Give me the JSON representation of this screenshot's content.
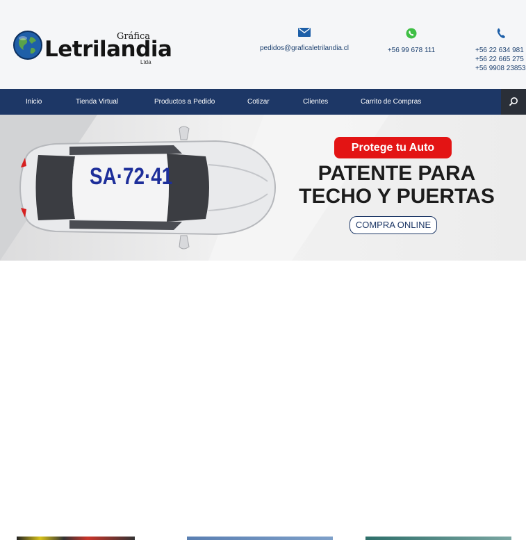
{
  "header": {
    "logo": {
      "small": "Gráfica",
      "main": "Letrilandia",
      "ltda": "Ltda"
    },
    "email": "pedidos@graficaletrilandia.cl",
    "whatsapp": "+56 99 678 111",
    "phones": [
      "+56 22 634 981",
      "+56 22 665 275",
      "+56 9908 23853"
    ]
  },
  "nav": {
    "items": [
      "Inicio",
      "Tienda Virtual",
      "Productos a Pedido",
      "Cotizar",
      "Clientes",
      "Carrito de Compras"
    ]
  },
  "hero": {
    "plate_text": "SA·72·41",
    "badge": "Protege tu Auto",
    "headline_1": "PATENTE PARA",
    "headline_2": "TECHO Y PUERTAS",
    "button": "COMPRA ONLINE"
  },
  "colors": {
    "navy": "#1d3766",
    "red": "#e31414",
    "contact": "#1b3f6e"
  },
  "icons": [
    "globe-icon",
    "email-icon",
    "whatsapp-icon",
    "phone-icon",
    "search-icon"
  ]
}
